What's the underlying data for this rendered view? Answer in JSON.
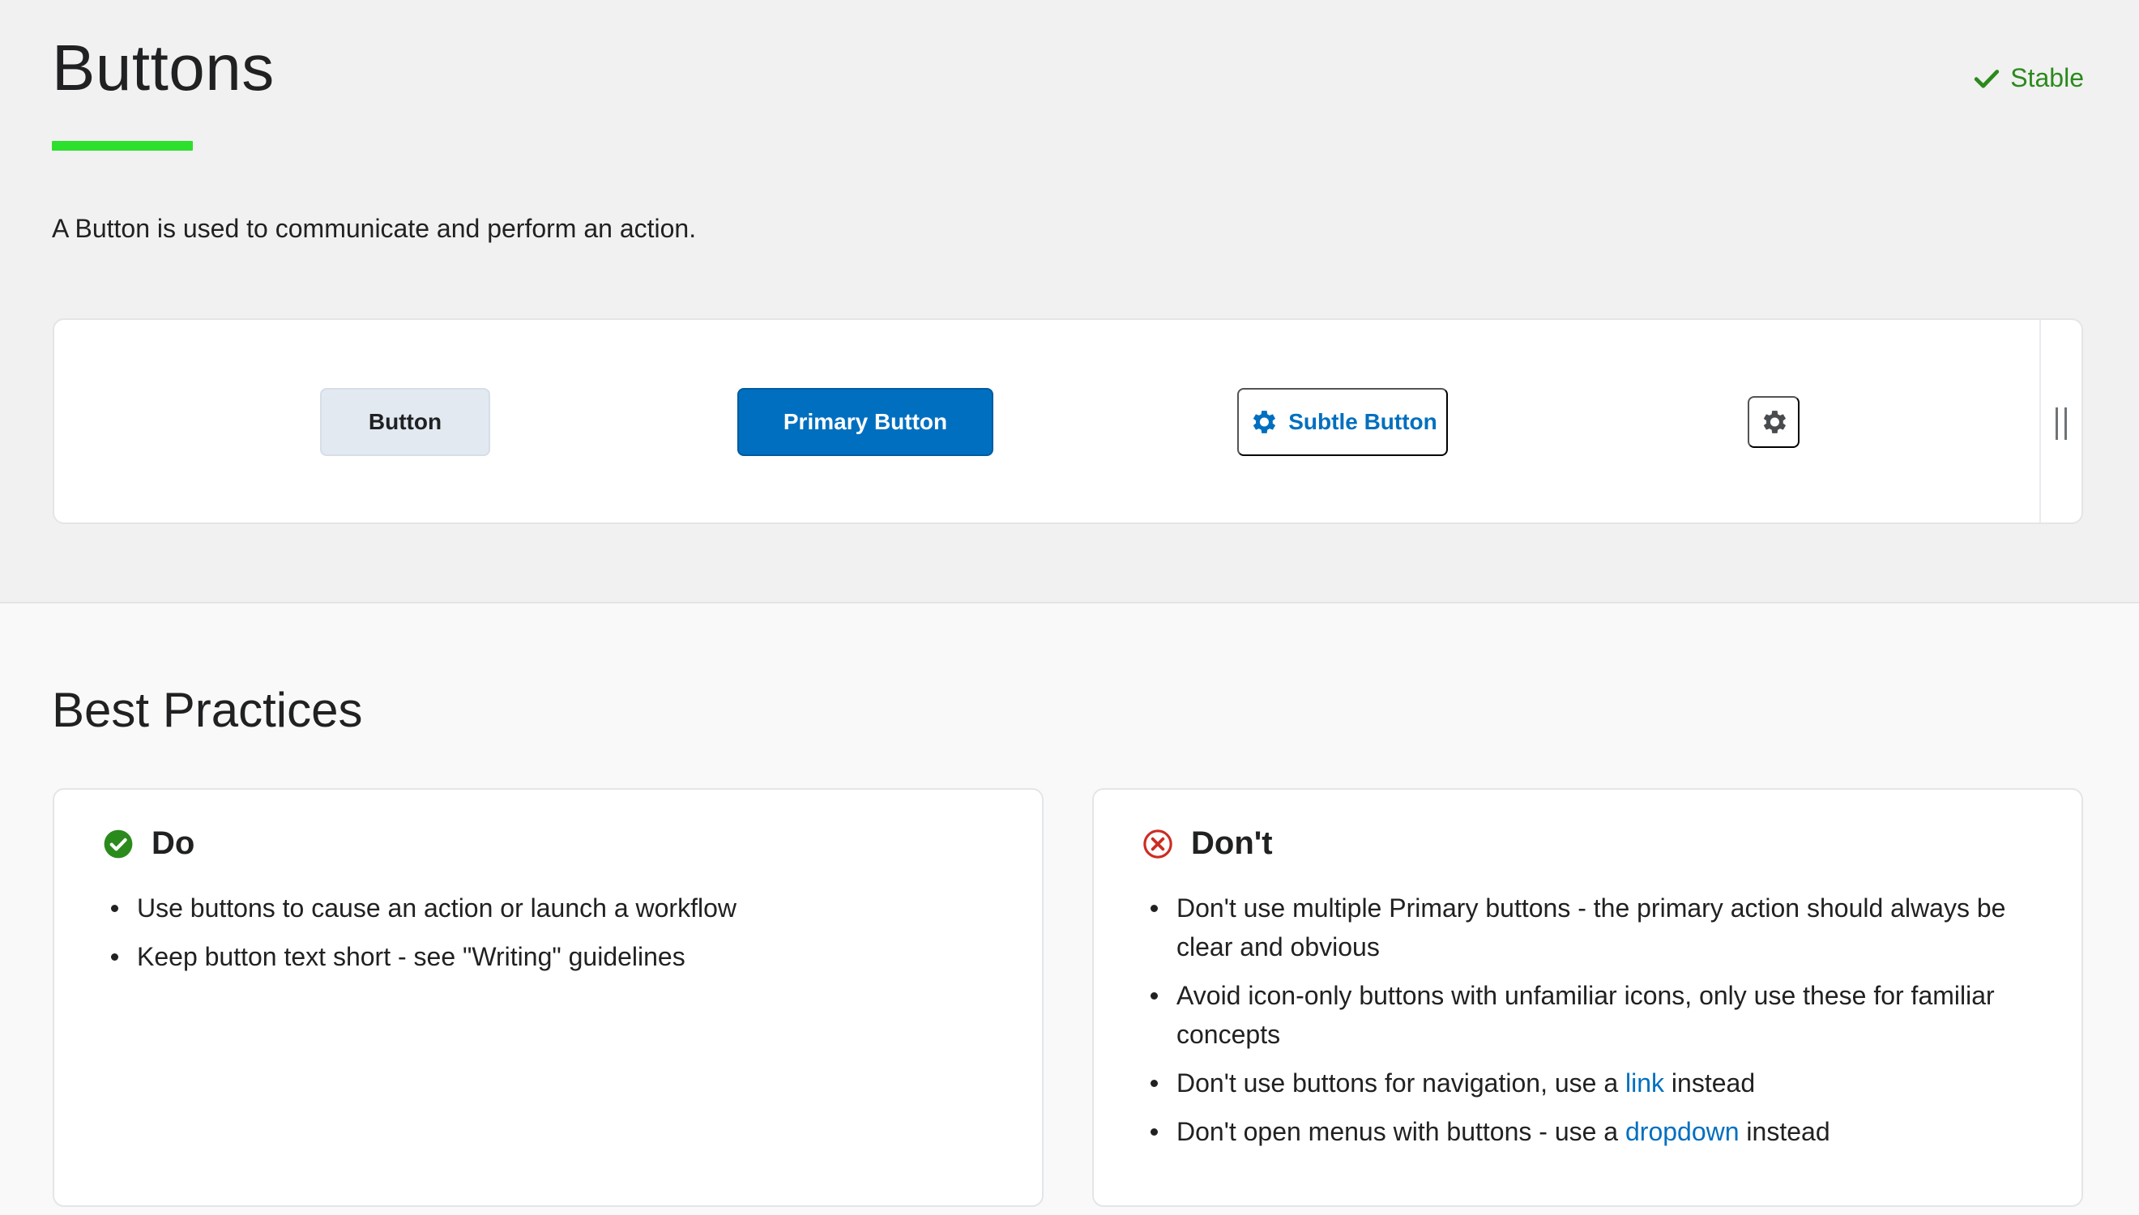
{
  "header": {
    "title": "Buttons",
    "status": "Stable",
    "intro": "A Button is used to communicate and perform an action."
  },
  "demo": {
    "button_label": "Button",
    "primary_label": "Primary Button",
    "subtle_label": "Subtle Button",
    "icon_button": "gear-icon"
  },
  "best_practices": {
    "title": "Best Practices",
    "do": {
      "heading": "Do",
      "items": [
        "Use buttons to cause an action or launch a workflow",
        "Keep button text short - see \"Writing\" guidelines"
      ]
    },
    "dont": {
      "heading": "Don't",
      "items": [
        {
          "text": "Don't use multiple Primary buttons - the primary action should always be clear and obvious"
        },
        {
          "text": "Avoid icon-only buttons with unfamiliar icons, only use these for familiar concepts"
        },
        {
          "before": "Don't use buttons for navigation, use a ",
          "link": "link",
          "after": " instead"
        },
        {
          "before": "Don't open menus with buttons - use a ",
          "link": "dropdown",
          "after": " instead"
        }
      ]
    }
  },
  "colors": {
    "accent": "#2de02d",
    "primary": "#006fbf",
    "success": "#2b8a1c",
    "error": "#cd2c23"
  }
}
